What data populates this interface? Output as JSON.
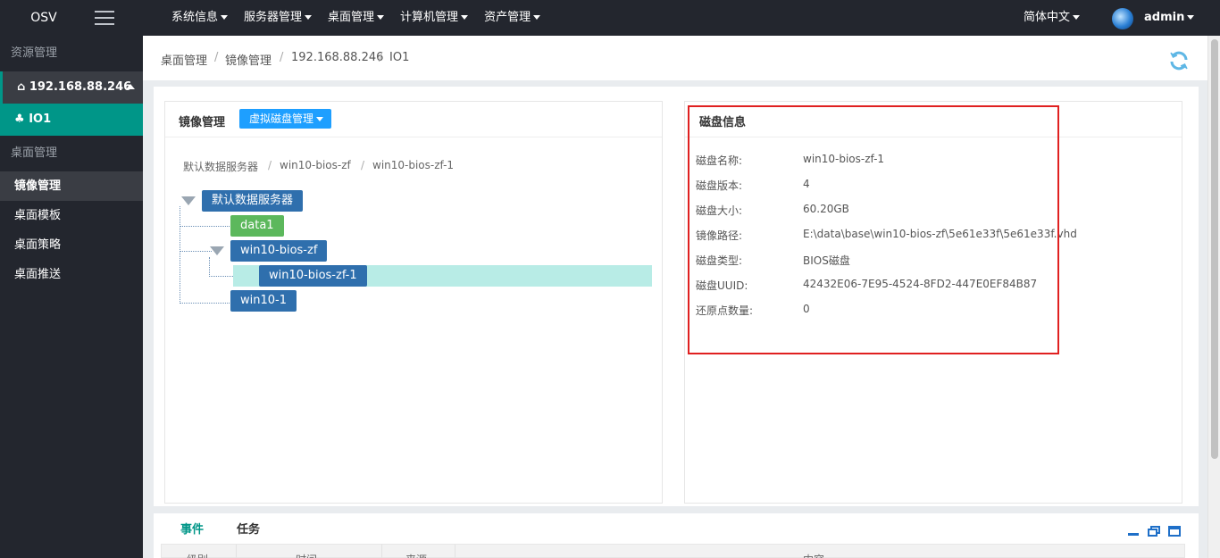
{
  "app": {
    "brand": "OSV"
  },
  "topnav": {
    "items": [
      {
        "label": "系统信息"
      },
      {
        "label": "服务器管理"
      },
      {
        "label": "桌面管理"
      },
      {
        "label": "计算机管理"
      },
      {
        "label": "资产管理"
      }
    ],
    "language": "简体中文",
    "user": "admin"
  },
  "sidebar": {
    "section_resources": "资源管理",
    "host": "192.168.88.246",
    "host_child": "IO1",
    "section_desktop": "桌面管理",
    "items": [
      {
        "label": "镜像管理",
        "active": true
      },
      {
        "label": "桌面模板"
      },
      {
        "label": "桌面策略"
      },
      {
        "label": "桌面推送"
      }
    ]
  },
  "breadcrumb": [
    "桌面管理",
    "镜像管理",
    "192.168.88.246",
    "IO1"
  ],
  "left_panel": {
    "title": "镜像管理",
    "dropdown": "虚拟磁盘管理",
    "path": [
      "默认数据服务器",
      "win10-bios-zf",
      "win10-bios-zf-1"
    ],
    "tree": {
      "root": "默认数据服务器",
      "data1": "data1",
      "win10_bios_zf": "win10-bios-zf",
      "win10_bios_zf_1": "win10-bios-zf-1",
      "win10_1": "win10-1"
    }
  },
  "disk_info": {
    "title": "磁盘信息",
    "rows": [
      {
        "key": "磁盘名称:",
        "value": "win10-bios-zf-1"
      },
      {
        "key": "磁盘版本:",
        "value": "4"
      },
      {
        "key": "磁盘大小:",
        "value": "60.20GB"
      },
      {
        "key": "镜像路径:",
        "value": "E:\\data\\base\\win10-bios-zf\\5e61e33f\\5e61e33f.vhd"
      },
      {
        "key": "磁盘类型:",
        "value": "BIOS磁盘"
      },
      {
        "key": "磁盘UUID:",
        "value": "42432E06-7E95-4524-8FD2-447E0EF84B87"
      },
      {
        "key": "还原点数量:",
        "value": "0"
      }
    ]
  },
  "bottom": {
    "tabs": [
      {
        "label": "事件",
        "active": true
      },
      {
        "label": "任务"
      }
    ],
    "columns": [
      "级别",
      "时间",
      "来源",
      "内容"
    ]
  },
  "colors": {
    "accent": "#009688",
    "topbar": "#23262e",
    "node": "#2f6fad",
    "node_green": "#5cb85c",
    "highlight": "#b8ece6",
    "annotation_box": "#e02020"
  }
}
